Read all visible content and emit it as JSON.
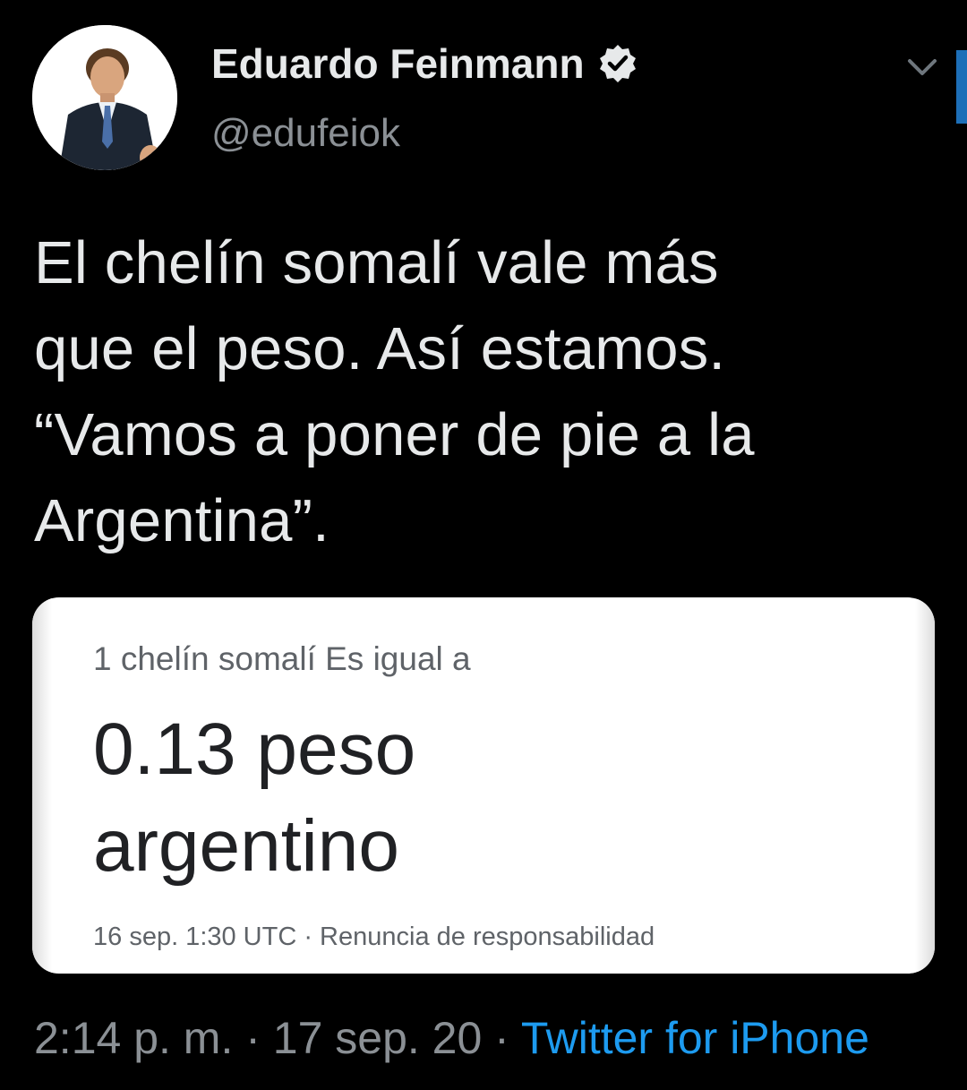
{
  "author": {
    "display_name": "Eduardo Feinmann",
    "handle": "@edufeiok",
    "verified": true
  },
  "tweet": {
    "text_lines": [
      "El chelín somalí vale más",
      "que el peso.  Así estamos.",
      "“Vamos a poner de pie a la",
      "Argentina”."
    ]
  },
  "media": {
    "label": "1 chelín somalí Es igual a",
    "result_lines": [
      "0.13 peso",
      "argentino"
    ],
    "footer": "16 sep. 1:30 UTC · Renuncia de responsabilidad"
  },
  "meta": {
    "time_date": "2:14 p. m. · 17 sep. 20 · ",
    "source": "Twitter for iPhone"
  },
  "colors": {
    "background": "#000000",
    "link": "#1d9bf0",
    "secondary_text": "#8b9095"
  }
}
